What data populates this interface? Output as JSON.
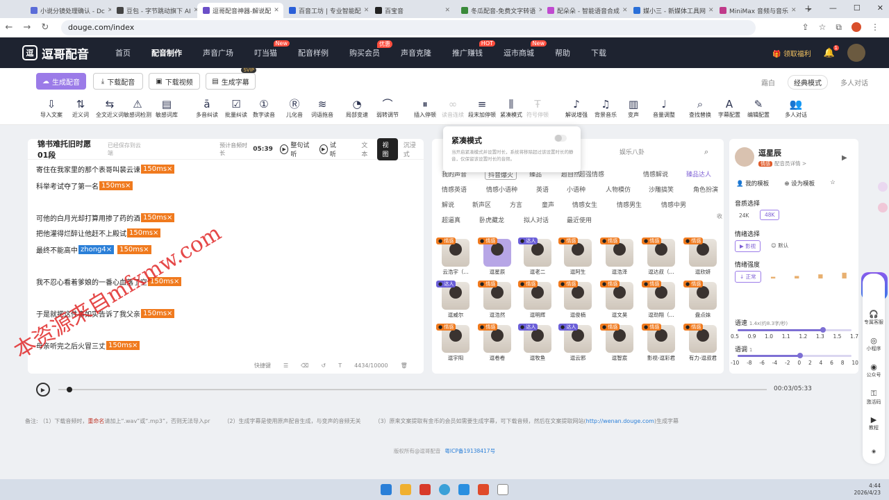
{
  "browser": {
    "tabs": [
      {
        "label": "小说分镜处理确认 - Dc",
        "color": "#5a6cd8"
      },
      {
        "label": "豆包 - 字节跳动旗下 AI",
        "color": "#444"
      },
      {
        "label": "逗哥配音神器-解说配",
        "color": "#6b4fc8",
        "active": true
      },
      {
        "label": "百音工坊 | 专业智能配",
        "color": "#2a5fd8"
      },
      {
        "label": "百宝音",
        "color": "#222"
      },
      {
        "label": "冬瓜配音-免费文字转语",
        "color": "#3a8a3a"
      },
      {
        "label": "配朵朵 - 智能语音合成",
        "color": "#c04ad0"
      },
      {
        "label": "媒小三 - 新媒体工具网",
        "color": "#2a6fd8"
      },
      {
        "label": "MiniMax 音频与音乐",
        "color": "#c03a8a"
      }
    ],
    "new_tab": "+",
    "win_controls": [
      "⌄",
      "—",
      "☐",
      "✕"
    ],
    "url": "douge.com/index"
  },
  "site": {
    "logo": "逗哥配音",
    "menu": [
      {
        "label": "首页"
      },
      {
        "label": "配音制作",
        "active": true
      },
      {
        "label": "声音广场"
      },
      {
        "label": "叮当猫",
        "badge": "New"
      },
      {
        "label": "配音样例"
      },
      {
        "label": "购买会员",
        "badge": "优惠"
      },
      {
        "label": "声音克隆"
      },
      {
        "label": "推广赚钱",
        "badge": "HOT"
      },
      {
        "label": "逗市商城",
        "badge": "New"
      },
      {
        "label": "帮助"
      },
      {
        "label": "下载"
      }
    ],
    "welfare": "领取福利",
    "bell_count": "1"
  },
  "toolbar": {
    "generate": "生成配音",
    "download_audio": "下载配音",
    "download_video": "下载视频",
    "subtitles": "生成字幕",
    "svip": "SVIP",
    "view": [
      "霜白",
      "经典模式",
      "多人对话"
    ],
    "tools": [
      "导入文案",
      "近义词",
      "全文近义词",
      "敏感词检测",
      "敏感词库",
      "多音纠读",
      "批量纠读",
      "数字读音",
      "儿化音",
      "词语拖音",
      "局部变速",
      "弱转调节",
      "插入停顿",
      "读音连续",
      "段末加停顿",
      "紧凑模式",
      "符号停顿",
      "解说增强",
      "背景音乐",
      "变声",
      "音量调整",
      "查找替换",
      "字幕配置",
      "编辑配置",
      "多人对话"
    ]
  },
  "editor": {
    "title": "锦书难托旧时愿01段",
    "saved": "已经保存到云端",
    "duration_label": "预计音频时长",
    "duration": "05:39",
    "whole_trial": "整句试听",
    "trial": "试听",
    "view_tabs": [
      "文本",
      "视图",
      "沉浸式"
    ],
    "lines": [
      {
        "text": "寄住在我家里的那个表哥叫裴云谏",
        "tag": "150ms×"
      },
      {
        "text": "科举考试夺了第一名",
        "tag": "150ms×"
      },
      {
        "text": "可他的白月光却打算用掺了药的酒",
        "tag": "150ms×"
      },
      {
        "text": "把他灌得烂醉让他赶不上殿试",
        "tag": "150ms×"
      },
      {
        "text": "最终不能高中",
        "pinyin": "zhong4×",
        "tag": "150ms×"
      },
      {
        "text": "我不忍心看着爹娘的一番心血落了空",
        "tag": "150ms×"
      },
      {
        "text": "于是就把这件事如实告诉了我父亲",
        "tag": "150ms×"
      },
      {
        "text": "母亲听完之后火冒三丈",
        "tag": "150ms×"
      }
    ],
    "shortcut": "快捷键",
    "count": "4434/10000",
    "watermark": "本资源来自mfxmw.com"
  },
  "voices": {
    "search_placeholder": "娱乐八卦",
    "cats": [
      "我的声音",
      "抖音爆火",
      "臻品",
      "超自然",
      "超强情感",
      "情感解说",
      "臻品达人",
      "情感英语",
      "情感小语种",
      "英语",
      "小语种",
      "人物模仿",
      "沙雕搞笑",
      "角色扮演",
      "解说",
      "新声区",
      "方言",
      "童声",
      "情感女生",
      "情感男生",
      "情感中男",
      "超逼真",
      "卧虎藏龙",
      "拟人对话",
      "最近使用"
    ],
    "collapse": "收",
    "cards": [
      {
        "name": "云浩宇（...",
        "label": "情感"
      },
      {
        "name": "逗星辰",
        "label": "情感",
        "sel": true
      },
      {
        "name": "逗老二",
        "label": "达人"
      },
      {
        "name": "逗阿生",
        "label": "情感"
      },
      {
        "name": "逗浩泽",
        "label": "情感"
      },
      {
        "name": "逗达叔（...",
        "label": "情感"
      },
      {
        "name": "逗欣妍",
        "label": "情感"
      },
      {
        "name": "逗威尔",
        "label": "达人"
      },
      {
        "name": "逗浩然",
        "label": "情感"
      },
      {
        "name": "逗明辉",
        "label": "情感"
      },
      {
        "name": "逗俊楠",
        "label": "情感"
      },
      {
        "name": "逗文昊",
        "label": "情感"
      },
      {
        "name": "逗劲翔（...",
        "label": "情感"
      },
      {
        "name": "盘点妹",
        "label": "情感"
      },
      {
        "name": "逗宇阳",
        "label": "情感"
      },
      {
        "name": "逗卷卷",
        "label": "情感"
      },
      {
        "name": "逗牧鱼",
        "label": "达人"
      },
      {
        "name": "逗云邪",
        "label": "达人"
      },
      {
        "name": "逗智宸",
        "label": "情感"
      },
      {
        "name": "影视-逗彩君",
        "label": "情感"
      },
      {
        "name": "有力-逗叔君",
        "label": "情感"
      }
    ]
  },
  "popup": {
    "title": "紧凑模式",
    "desc": "当开启紧凑模式并设置时长，系统将移除超过该设置时长的静音，仅保留该设置时长的音频。"
  },
  "detail": {
    "name": "逗星辰",
    "tag": "情感",
    "link": "配音员详情 >",
    "my_template": "我的模板",
    "set_template": "设为模板",
    "quality_label": "音质选择",
    "quality": [
      "24K",
      "48K"
    ],
    "emotion_label": "情绪选择",
    "emotions": [
      "影视",
      "默认"
    ],
    "intensity_label": "情绪强度",
    "intensity": "正常",
    "speed_label": "语速",
    "speed_value": "1.4x(约8.3字/秒)",
    "speed_level": 0.75,
    "speed_ticks": [
      "0.5",
      "0.9",
      "1.0",
      "1.1",
      "1.2",
      "1.3",
      "1.5",
      "1.7"
    ],
    "pitch_label": "语调",
    "pitch_value": "1",
    "pitch_level": 0.55,
    "pitch_ticks": [
      "-10",
      "-8",
      "-6",
      "-4",
      "-2",
      "0",
      "2",
      "4",
      "6",
      "8",
      "10"
    ]
  },
  "dock": {
    "ai": "AI调音",
    "items": [
      "专属客服",
      "小程序",
      "公众号",
      "激活码",
      "教程"
    ]
  },
  "player": {
    "time": "00:03/05:33",
    "progress": 0.01
  },
  "notes": [
    {
      "text": "备注:  （1）下载音频时，"
    },
    {
      "k": "重命名"
    },
    {
      "text": "请加上“.wav”或“.mp3”，否则无法导入pr"
    },
    {
      "text": "（2）生成字幕是使用原声配音生成，与变声的音频无关"
    },
    {
      "text": "（3）原来文案提取有金币的会员如需要生成字幕，可下载音频，然后在文案提取网站("
    },
    {
      "u": "http://wenan.douge.com"
    },
    {
      "text": ")生成字幕"
    }
  ],
  "copyright": {
    "text": "版权所有@逗哥配音",
    "icp": "粤ICP备19138417号"
  },
  "taskbar": {
    "time": "4:44",
    "date": "2026/4/23"
  }
}
